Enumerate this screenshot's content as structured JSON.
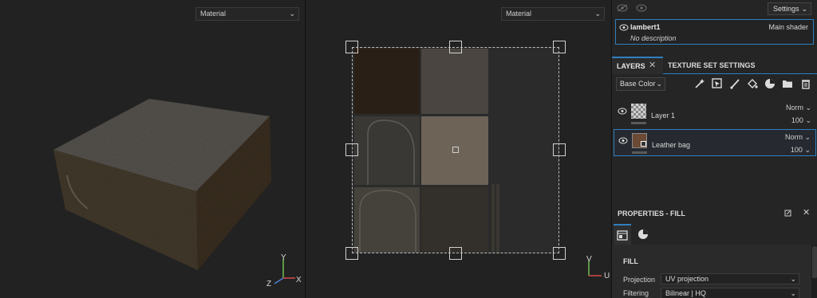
{
  "viewport3d": {
    "material_select": "Material",
    "axes": {
      "y": "Y",
      "x": "X",
      "z": "Z"
    }
  },
  "viewport2d": {
    "material_select": "Material",
    "axes": {
      "v": "V",
      "u": "U"
    }
  },
  "panel": {
    "settings_label": "Settings",
    "shader": {
      "name": "lambert1",
      "type": "Main shader",
      "description": "No description"
    },
    "tabs": [
      {
        "label": "LAYERS",
        "active": true
      },
      {
        "label": "TEXTURE SET SETTINGS",
        "active": false
      }
    ],
    "channel": "Base Color",
    "toolbar_icons": [
      "magic-wand-icon",
      "add-mask-icon",
      "paint-brush-icon",
      "fill-bucket-icon",
      "material-ball-icon",
      "folder-icon",
      "trash-icon"
    ],
    "layers": [
      {
        "name": "Layer 1",
        "blend": "Norm",
        "opacity": "100",
        "selected": false
      },
      {
        "name": "Leather bag",
        "blend": "Norm",
        "opacity": "100",
        "selected": true
      }
    ],
    "properties": {
      "title": "PROPERTIES - FILL",
      "section": "FILL",
      "projection_label": "Projection",
      "projection_value": "UV projection",
      "filtering_label": "Filtering",
      "filtering_value": "Bilinear | HQ"
    }
  },
  "colors": {
    "accent": "#2f7fbf",
    "background": "#222222",
    "panel": "#252525"
  }
}
